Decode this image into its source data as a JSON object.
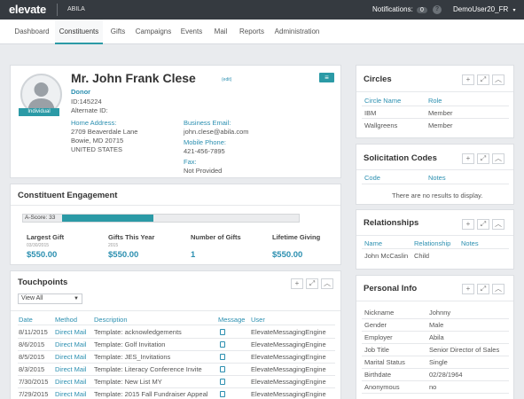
{
  "topbar": {
    "logo": "elevate",
    "org": "ABILA",
    "notifications_label": "Notifications:",
    "notifications_count": "0",
    "help": "?",
    "user": "DemoUser20_FR",
    "user_caret": "▾"
  },
  "nav": {
    "tabs": [
      "Dashboard",
      "Constituents",
      "Gifts",
      "Campaigns",
      "Events",
      "Mail",
      "Reports",
      "Administration"
    ],
    "active": "Constituents"
  },
  "profile": {
    "name": "Mr. John Frank Clese",
    "edit": "(edit)",
    "menu_icon": "≡",
    "type_tag": "Individual",
    "type": "Donor",
    "id": "ID:145224",
    "alternate_id": "Alternate ID:",
    "home_address_label": "Home Address:",
    "address_line1": "2709 Beaverdale Lane",
    "address_line2": "Bowie, MD 20715",
    "address_line3": "UNITED STATES",
    "business_email_label": "Business Email:",
    "business_email": "john.clese@abila.com",
    "mobile_phone_label": "Mobile Phone:",
    "mobile_phone": "421-456-7895",
    "fax_label": "Fax:",
    "fax": "Not Provided"
  },
  "engagement": {
    "title": "Constituent Engagement",
    "a_score_label": "A-Score: 33",
    "a_score": 33,
    "stats": [
      {
        "label": "Largest Gift",
        "date": "03/30/2015",
        "value": "$550.00"
      },
      {
        "label": "Gifts This Year",
        "date": "2015",
        "value": "$550.00"
      },
      {
        "label": "Number of Gifts",
        "date": "",
        "value": "1"
      },
      {
        "label": "Lifetime Giving",
        "date": "",
        "value": "$550.00"
      }
    ]
  },
  "touchpoints": {
    "title": "Touchpoints",
    "filter_value": "View All",
    "columns": [
      "Date",
      "Method",
      "Description",
      "Message",
      "User"
    ],
    "rows": [
      [
        "8/11/2015",
        "Direct Mail",
        "Template: acknowledgements",
        "",
        "ElevateMessagingEngine"
      ],
      [
        "8/6/2015",
        "Direct Mail",
        "Template: Golf Invitation",
        "",
        "ElevateMessagingEngine"
      ],
      [
        "8/5/2015",
        "Direct Mail",
        "Template: JES_Invitations",
        "",
        "ElevateMessagingEngine"
      ],
      [
        "8/3/2015",
        "Direct Mail",
        "Template: Literacy Conference Invite",
        "",
        "ElevateMessagingEngine"
      ],
      [
        "7/30/2015",
        "Direct Mail",
        "Template: New List MY",
        "",
        "ElevateMessagingEngine"
      ],
      [
        "7/29/2015",
        "Direct Mail",
        "Template: 2015 Fall Fundraiser Appeal",
        "",
        "ElevateMessagingEngine"
      ]
    ]
  },
  "circles": {
    "title": "Circles",
    "columns": [
      "Circle Name",
      "Role"
    ],
    "rows": [
      [
        "IBM",
        "Member"
      ],
      [
        "Wallgreens",
        "Member"
      ]
    ]
  },
  "solicitation": {
    "title": "Solicitation Codes",
    "columns": [
      "Code",
      "Notes"
    ],
    "empty": "There are no results to display."
  },
  "relationships": {
    "title": "Relationships",
    "columns": [
      "Name",
      "Relationship",
      "Notes"
    ],
    "rows": [
      [
        "John McCaslin",
        "Child",
        ""
      ]
    ]
  },
  "personal": {
    "title": "Personal Info",
    "rows": [
      [
        "Nickname",
        "Johnny"
      ],
      [
        "Gender",
        "Male"
      ],
      [
        "Employer",
        "Abila"
      ],
      [
        "Job Title",
        "Senior Director of Sales"
      ],
      [
        "Marital Status",
        "Single"
      ],
      [
        "Birthdate",
        "02/28/1964"
      ],
      [
        "Anonymous",
        "no"
      ]
    ]
  },
  "controls": {
    "add": "+",
    "expand": "⤢",
    "collapse": "︿"
  }
}
